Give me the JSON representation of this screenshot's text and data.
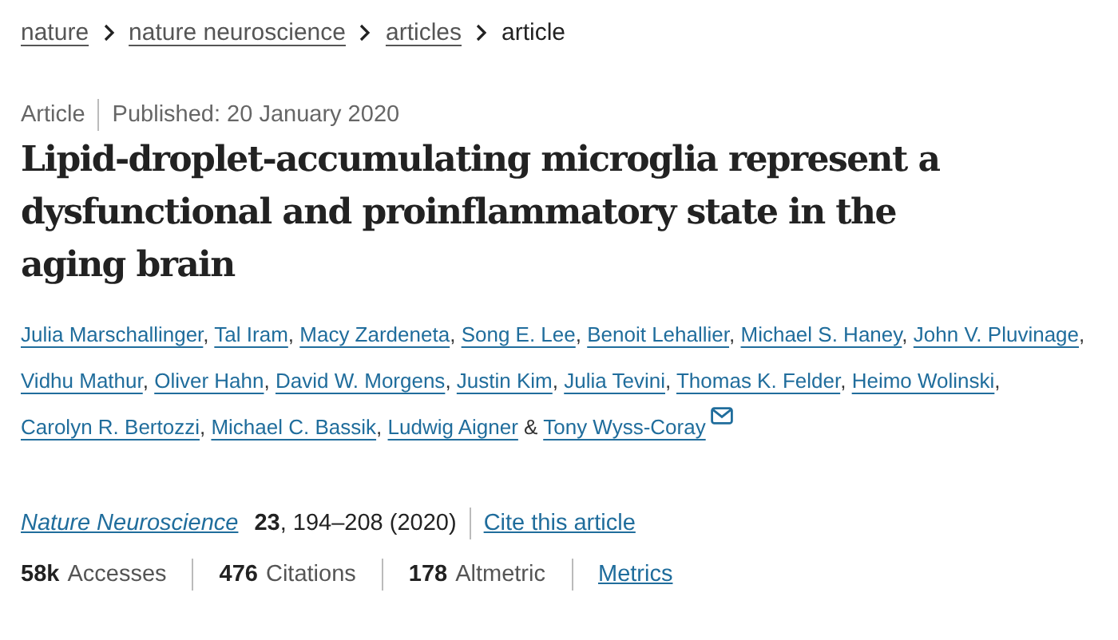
{
  "breadcrumbs": [
    {
      "label": "nature",
      "current": false
    },
    {
      "label": "nature neuroscience",
      "current": false
    },
    {
      "label": "articles",
      "current": false
    },
    {
      "label": "article",
      "current": true
    }
  ],
  "article_type": "Article",
  "published": "Published: 20 January 2020",
  "title": "Lipid-droplet-accumulating microglia represent a dysfunctional and proinflammatory state in the aging brain",
  "authors": [
    {
      "name": "Julia Marschallinger",
      "sep": ","
    },
    {
      "name": "Tal Iram",
      "sep": ","
    },
    {
      "name": "Macy Zardeneta",
      "sep": ","
    },
    {
      "name": "Song E. Lee",
      "sep": ","
    },
    {
      "name": "Benoit Lehallier",
      "sep": ","
    },
    {
      "name": "Michael S. Haney",
      "sep": ","
    },
    {
      "name": "John V. Pluvinage",
      "sep": ","
    },
    {
      "name": "Vidhu Mathur",
      "sep": ","
    },
    {
      "name": "Oliver Hahn",
      "sep": ","
    },
    {
      "name": "David W. Morgens",
      "sep": ","
    },
    {
      "name": "Justin Kim",
      "sep": ","
    },
    {
      "name": "Julia Tevini",
      "sep": ","
    },
    {
      "name": "Thomas K. Felder",
      "sep": ","
    },
    {
      "name": "Heimo Wolinski",
      "sep": ","
    },
    {
      "name": "Carolyn R. Bertozzi",
      "sep": ","
    },
    {
      "name": "Michael C. Bassik",
      "sep": ","
    },
    {
      "name": "Ludwig Aigner",
      "sep": " &"
    },
    {
      "name": "Tony Wyss-Coray",
      "email": true
    }
  ],
  "citation": {
    "journal": "Nature Neuroscience",
    "volume": "23",
    "pages": ", 194–208 (2020)",
    "cite_link": "Cite this article"
  },
  "metrics": [
    {
      "value": "58k",
      "label": "Accesses"
    },
    {
      "value": "476",
      "label": "Citations"
    },
    {
      "value": "178",
      "label": "Altmetric"
    }
  ],
  "metrics_link": "Metrics"
}
